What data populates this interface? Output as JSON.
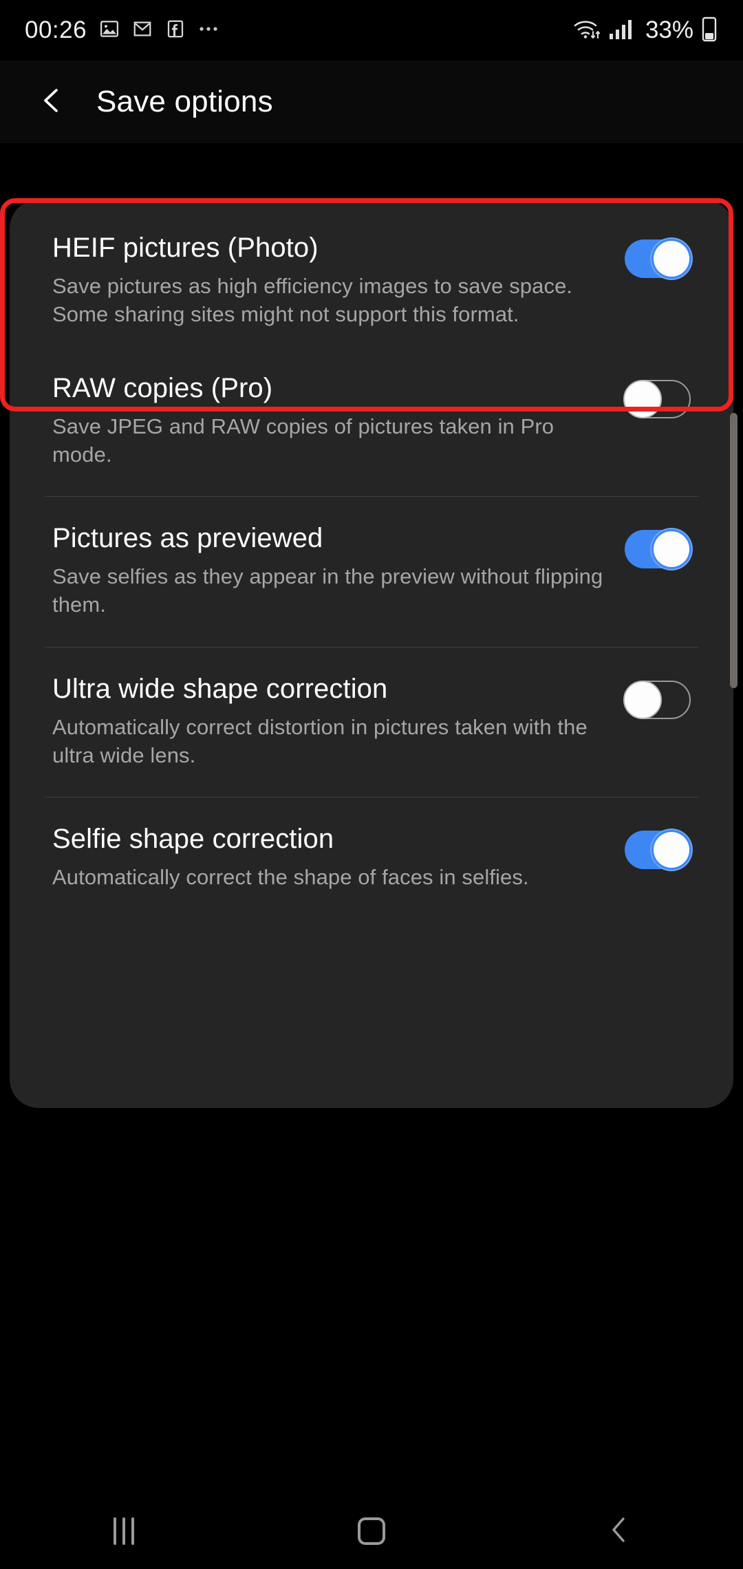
{
  "status_bar": {
    "time": "00:26",
    "battery_percent": "33%",
    "left_icons": [
      "gallery-icon",
      "gmail-icon",
      "facebook-icon",
      "more-notifications-icon"
    ],
    "right_icons": [
      "wifi-icon",
      "cellular-signal-icon",
      "battery-icon"
    ]
  },
  "header": {
    "back_icon": "chevron-left-icon",
    "title": "Save options"
  },
  "colors": {
    "accent_on": "#3d86f4",
    "highlight_border": "#ee2222",
    "card_bg": "#252525",
    "page_bg": "#000000",
    "title_text": "#ffffff",
    "desc_text": "#a6a6a6"
  },
  "settings": [
    {
      "id": "heif-pictures",
      "title": "HEIF pictures (Photo)",
      "description": "Save pictures as high efficiency images to save space. Some sharing sites might not support this format.",
      "toggle_state": "on",
      "highlighted": true
    },
    {
      "id": "raw-copies",
      "title": "RAW copies (Pro)",
      "description": "Save JPEG and RAW copies of pictures taken in Pro mode.",
      "toggle_state": "off",
      "highlighted": false
    },
    {
      "id": "pictures-as-previewed",
      "title": "Pictures as previewed",
      "description": "Save selfies as they appear in the preview without flipping them.",
      "toggle_state": "on",
      "highlighted": false
    },
    {
      "id": "ultra-wide-shape-correction",
      "title": "Ultra wide shape correction",
      "description": "Automatically correct distortion in pictures taken with the ultra wide lens.",
      "toggle_state": "off",
      "highlighted": false
    },
    {
      "id": "selfie-shape-correction",
      "title": "Selfie shape correction",
      "description": "Automatically correct the shape of faces in selfies.",
      "toggle_state": "on",
      "highlighted": false
    }
  ],
  "nav_bar": {
    "recents_icon": "recents-icon",
    "home_icon": "home-icon",
    "back_icon": "back-icon"
  }
}
